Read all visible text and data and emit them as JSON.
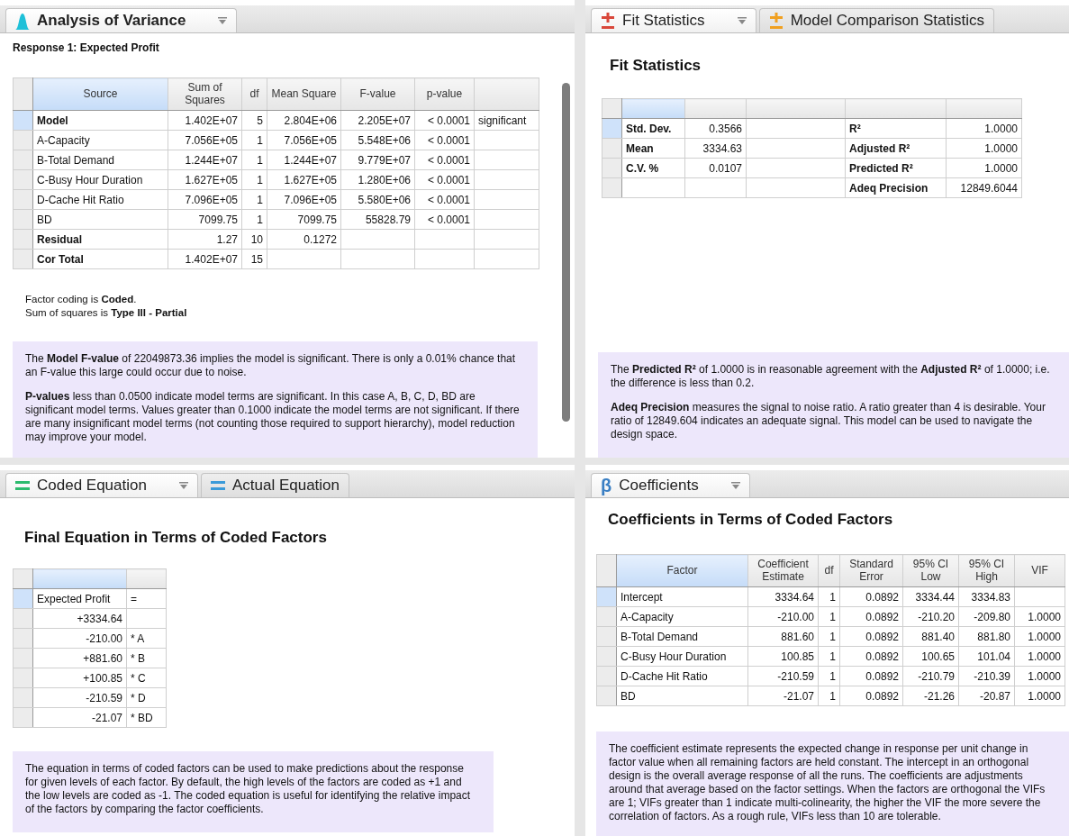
{
  "panes": [
    {
      "kind": "anova",
      "tabs": [
        {
          "label": "Analysis of Variance",
          "selected": true,
          "kind": "bell",
          "color": "#1ec0d8"
        }
      ],
      "response_title": "Response 1: Expected Profit",
      "table": {
        "columns": [
          "Source",
          "Sum of Squares",
          "df",
          "Mean Square",
          "F-value",
          "p-value",
          null
        ],
        "rows": [
          {
            "selected": true,
            "bold": true,
            "cells": [
              "Model",
              "1.402E+07",
              "5",
              "2.804E+06",
              "2.205E+07",
              "< 0.0001",
              "significant"
            ]
          },
          {
            "selected": false,
            "bold": false,
            "cells": [
              "A-Capacity",
              "7.056E+05",
              "1",
              "7.056E+05",
              "5.548E+06",
              "< 0.0001",
              null
            ]
          },
          {
            "selected": false,
            "bold": false,
            "cells": [
              "B-Total Demand",
              "1.244E+07",
              "1",
              "1.244E+07",
              "9.779E+07",
              "< 0.0001",
              null
            ]
          },
          {
            "selected": false,
            "bold": false,
            "cells": [
              "C-Busy Hour Duration",
              "1.627E+05",
              "1",
              "1.627E+05",
              "1.280E+06",
              "< 0.0001",
              null
            ]
          },
          {
            "selected": false,
            "bold": false,
            "cells": [
              "D-Cache Hit Ratio",
              "7.096E+05",
              "1",
              "7.096E+05",
              "5.580E+06",
              "< 0.0001",
              null
            ]
          },
          {
            "selected": false,
            "bold": false,
            "cells": [
              "BD",
              "7099.75",
              "1",
              "7099.75",
              "55828.79",
              "< 0.0001",
              null
            ]
          },
          {
            "selected": false,
            "bold": true,
            "cells": [
              "Residual",
              "1.27",
              "10",
              "0.1272",
              null,
              null,
              null
            ]
          },
          {
            "selected": false,
            "bold": true,
            "cells": [
              "Cor Total",
              "1.402E+07",
              "15",
              null,
              null,
              null,
              null
            ]
          }
        ]
      },
      "notes": [
        "Factor coding is **Coded**.",
        "Sum of squares is **Type III - Partial**"
      ],
      "info": [
        "The **Model F-value** of 22049873.36 implies the model is significant. There is only a 0.01% chance that an F-value this large could occur due to noise.",
        "**P-values** less than 0.0500 indicate model terms are significant. In this case A, B, C, D, BD are significant model terms. Values greater than 0.1000 indicate the model terms are not significant. If there are many insignificant model terms (not counting those required to support hierarchy), model reduction may improve your model."
      ]
    },
    {
      "kind": "fit",
      "tabs": [
        {
          "label": "Fit Statistics",
          "selected": true,
          "kind": "plus-minus",
          "color": "#d9473a"
        },
        {
          "label": "Model Comparison Statistics",
          "selected": false,
          "kind": "plus-minus",
          "color": "#f0a020"
        }
      ],
      "heading": "Fit Statistics",
      "table": {
        "columns": [
          null,
          null,
          null,
          null,
          null
        ],
        "rows": [
          {
            "selected": true,
            "cells": [
              "Std. Dev.",
              "0.3566",
              null,
              "R²",
              "1.0000"
            ]
          },
          {
            "selected": false,
            "cells": [
              "Mean",
              "3334.63",
              null,
              "Adjusted R²",
              "1.0000"
            ]
          },
          {
            "selected": false,
            "cells": [
              "C.V. %",
              "0.0107",
              null,
              "Predicted R²",
              "1.0000"
            ]
          },
          {
            "selected": false,
            "cells": [
              null,
              null,
              null,
              "Adeq Precision",
              "12849.6044"
            ]
          }
        ]
      },
      "info": [
        "The **Predicted R²** of 1.0000 is in reasonable agreement with the **Adjusted R²** of 1.0000; i.e. the difference is less than 0.2.",
        "**Adeq Precision** measures the signal to noise ratio. A ratio greater than 4 is desirable. Your ratio of 12849.604 indicates an adequate signal. This model can be used to navigate the design space."
      ]
    },
    {
      "kind": "equation",
      "tabs": [
        {
          "label": "Coded Equation",
          "selected": true,
          "kind": "equals",
          "color": "#2dbb6e"
        },
        {
          "label": "Actual Equation",
          "selected": false,
          "kind": "equals",
          "color": "#3a9ad9"
        }
      ],
      "heading": "Final Equation in Terms of Coded Factors",
      "table": {
        "columns": [
          null,
          null
        ],
        "rows": [
          {
            "selected": true,
            "cells": [
              "Expected Profit",
              "="
            ]
          },
          {
            "selected": false,
            "cells": [
              "+3334.64",
              null
            ]
          },
          {
            "selected": false,
            "cells": [
              "-210.00",
              "* A"
            ]
          },
          {
            "selected": false,
            "cells": [
              "+881.60",
              "* B"
            ]
          },
          {
            "selected": false,
            "cells": [
              "+100.85",
              "* C"
            ]
          },
          {
            "selected": false,
            "cells": [
              "-210.59",
              "* D"
            ]
          },
          {
            "selected": false,
            "cells": [
              "-21.07",
              "* BD"
            ]
          }
        ]
      },
      "info": [
        "The equation in terms of coded factors can be used to make predictions about the response for given levels of each factor. By default, the high levels of the factors are coded as +1 and the low levels are coded as -1. The coded equation is useful for identifying the relative impact of the factors by comparing the factor coefficients."
      ]
    },
    {
      "kind": "coefficients",
      "tabs": [
        {
          "label": "Coefficients",
          "selected": true,
          "kind": "glyph",
          "glyph": "β",
          "color": "#3a7fc4"
        }
      ],
      "heading": "Coefficients in Terms of Coded Factors",
      "table": {
        "columns": [
          "Factor",
          "Coefficient Estimate",
          "df",
          "Standard Error",
          "95% CI Low",
          "95% CI High",
          "VIF"
        ],
        "rows": [
          {
            "selected": true,
            "cells": [
              "Intercept",
              "3334.64",
              "1",
              "0.0892",
              "3334.44",
              "3334.83",
              null
            ]
          },
          {
            "selected": false,
            "cells": [
              "A-Capacity",
              "-210.00",
              "1",
              "0.0892",
              "-210.20",
              "-209.80",
              "1.0000"
            ]
          },
          {
            "selected": false,
            "cells": [
              "B-Total Demand",
              "881.60",
              "1",
              "0.0892",
              "881.40",
              "881.80",
              "1.0000"
            ]
          },
          {
            "selected": false,
            "cells": [
              "C-Busy Hour Duration",
              "100.85",
              "1",
              "0.0892",
              "100.65",
              "101.04",
              "1.0000"
            ]
          },
          {
            "selected": false,
            "cells": [
              "D-Cache Hit Ratio",
              "-210.59",
              "1",
              "0.0892",
              "-210.79",
              "-210.39",
              "1.0000"
            ]
          },
          {
            "selected": false,
            "cells": [
              "BD",
              "-21.07",
              "1",
              "0.0892",
              "-21.26",
              "-20.87",
              "1.0000"
            ]
          }
        ]
      },
      "info": [
        "The coefficient estimate represents the expected change in response per unit change in factor value when all remaining factors are held constant. The intercept in an orthogonal design is the overall average response of all the runs. The coefficients are adjustments around that average based on the factor settings. When the factors are orthogonal the VIFs are 1; VIFs greater than 1 indicate multi-colinearity, the higher the VIF the more severe the correlation of factors. As a rough rule, VIFs less than 10 are tolerable."
      ]
    }
  ]
}
